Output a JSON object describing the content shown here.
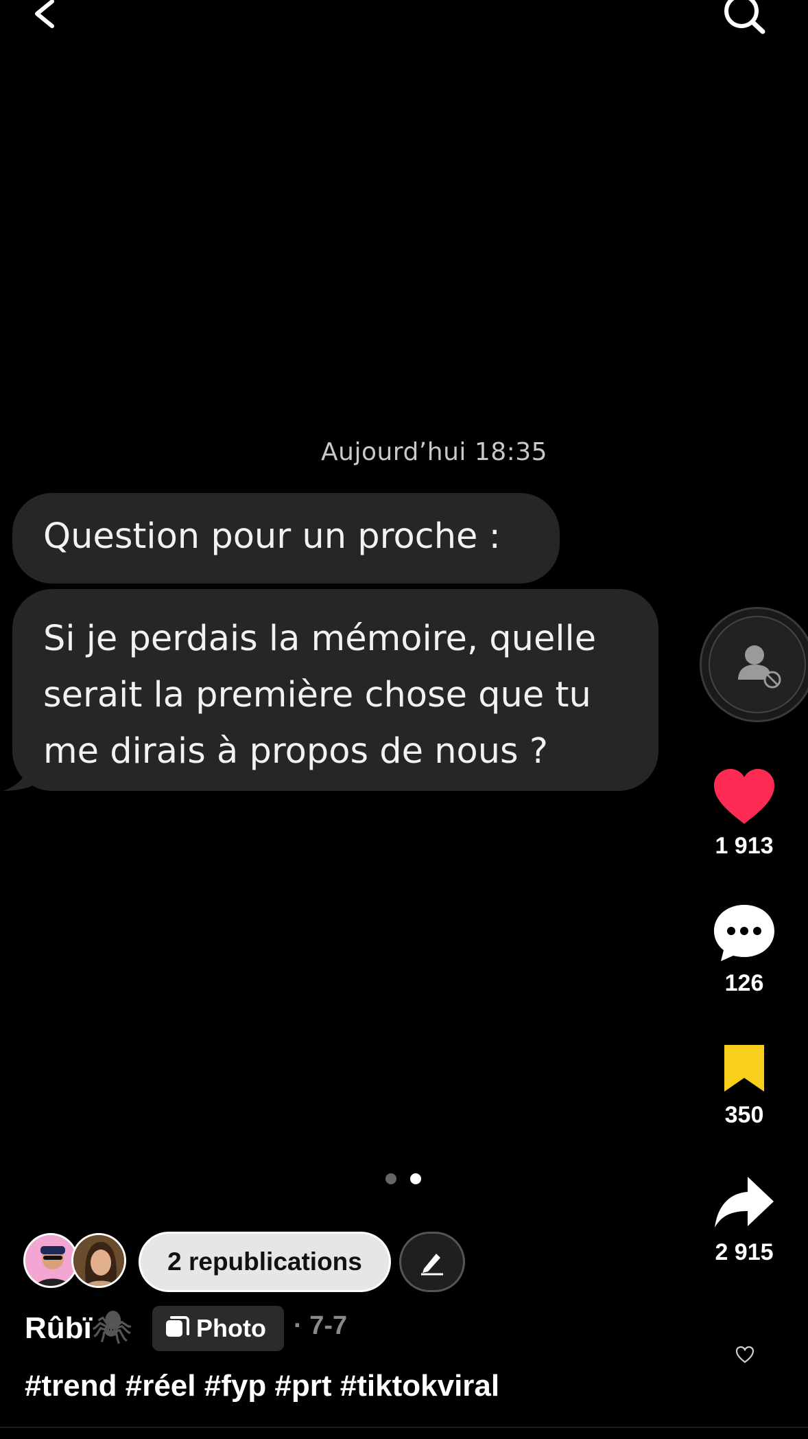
{
  "top_bar": {
    "back_icon": "chevron-left-icon",
    "search_icon": "search-icon"
  },
  "message": {
    "timestamp": "Aujourd’hui 18:35",
    "bubble_1": "Question pour un proche :",
    "bubble_2_lines": [
      "Si je perdais la mémoire, quelle",
      "serait la première chose que tu",
      "me dirais à propos de nous ?"
    ]
  },
  "rail": {
    "likes": "1 913",
    "comments": "126",
    "saves": "350",
    "shares": "2 915",
    "colors": {
      "like": "#fe2c55",
      "save": "#f9ce1d"
    }
  },
  "carousel": {
    "total": 2,
    "active": 2
  },
  "meta": {
    "republications_label": "2 republications",
    "username": "Rûbï",
    "username_emoji": "🕷",
    "content_type": "Photo",
    "date": "· 7-7",
    "hashtags": [
      "#trend",
      "#réel",
      "#fyp",
      "#prt",
      "#tiktokviral"
    ]
  }
}
